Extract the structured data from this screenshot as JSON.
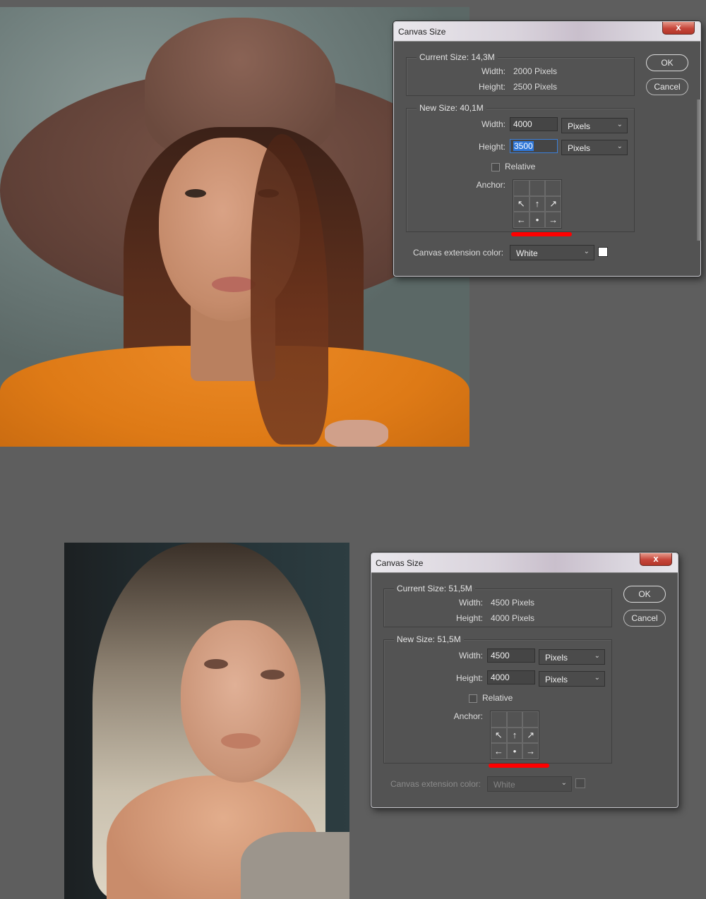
{
  "colors": {
    "accent": "#2f77d8",
    "highlight": "#ff0000",
    "background": "#5e5e5e",
    "dialog_bg": "#535353"
  },
  "dialogs": [
    {
      "title": "Canvas Size",
      "close_label": "x",
      "current_size": {
        "label": "Current Size: 14,3M",
        "width_label": "Width:",
        "width_value": "2000 Pixels",
        "height_label": "Height:",
        "height_value": "2500 Pixels"
      },
      "new_size": {
        "label": "New Size: 40,1M",
        "width_label": "Width:",
        "width_input": "4000",
        "width_unit": "Pixels",
        "height_label": "Height:",
        "height_input": "3500",
        "height_unit": "Pixels",
        "relative_label": "Relative",
        "anchor_label": "Anchor:"
      },
      "extension_label": "Canvas extension color:",
      "extension_value": "White",
      "ok_label": "OK",
      "cancel_label": "Cancel"
    },
    {
      "title": "Canvas Size",
      "close_label": "x",
      "current_size": {
        "label": "Current Size: 51,5M",
        "width_label": "Width:",
        "width_value": "4500 Pixels",
        "height_label": "Height:",
        "height_value": "4000 Pixels"
      },
      "new_size": {
        "label": "New Size: 51,5M",
        "width_label": "Width:",
        "width_input": "4500",
        "width_unit": "Pixels",
        "height_label": "Height:",
        "height_input": "4000",
        "height_unit": "Pixels",
        "relative_label": "Relative",
        "anchor_label": "Anchor:"
      },
      "extension_label": "Canvas extension color:",
      "extension_value": "White",
      "ok_label": "OK",
      "cancel_label": "Cancel"
    }
  ],
  "anchor_arrows": [
    "↖",
    "↑",
    "↗",
    "←",
    "•",
    "→",
    "",
    "",
    ""
  ]
}
